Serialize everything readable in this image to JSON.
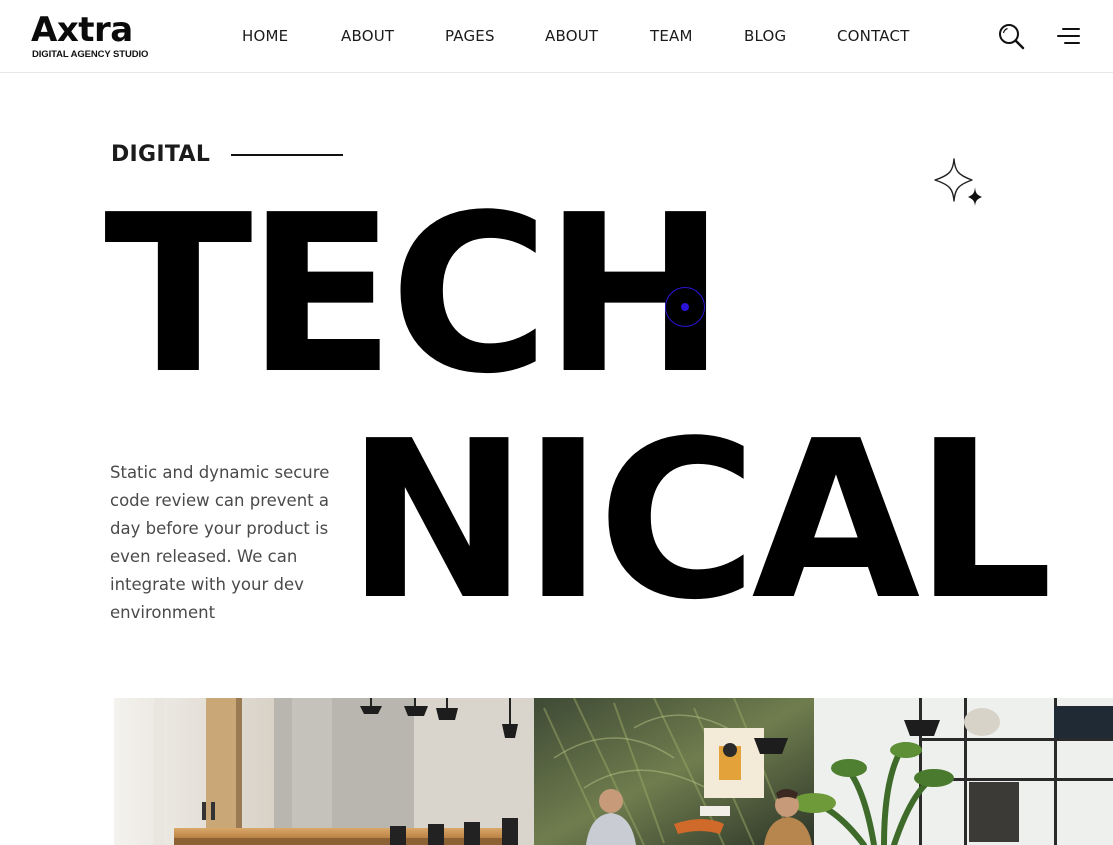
{
  "header": {
    "logo": {
      "wordmark": "Axtra",
      "tagline": "DIGITAL AGENCY STUDIO"
    },
    "nav": [
      {
        "label": "HOME"
      },
      {
        "label": "ABOUT"
      },
      {
        "label": "PAGES"
      },
      {
        "label": "ABOUT"
      },
      {
        "label": "TEAM"
      },
      {
        "label": "BLOG"
      },
      {
        "label": "CONTACT"
      }
    ],
    "icons": {
      "search": "search-icon",
      "menu": "menu-icon"
    }
  },
  "hero": {
    "eyebrow": "DIGITAL",
    "headline_top": "TECH",
    "headline_bottom": "NICAL",
    "description": "Static and dynamic secure code review can prevent a day before your product is even released. We can integrate with your dev environment",
    "accent_color": "#2b14d8"
  },
  "media": {
    "photo": "office-photo"
  }
}
